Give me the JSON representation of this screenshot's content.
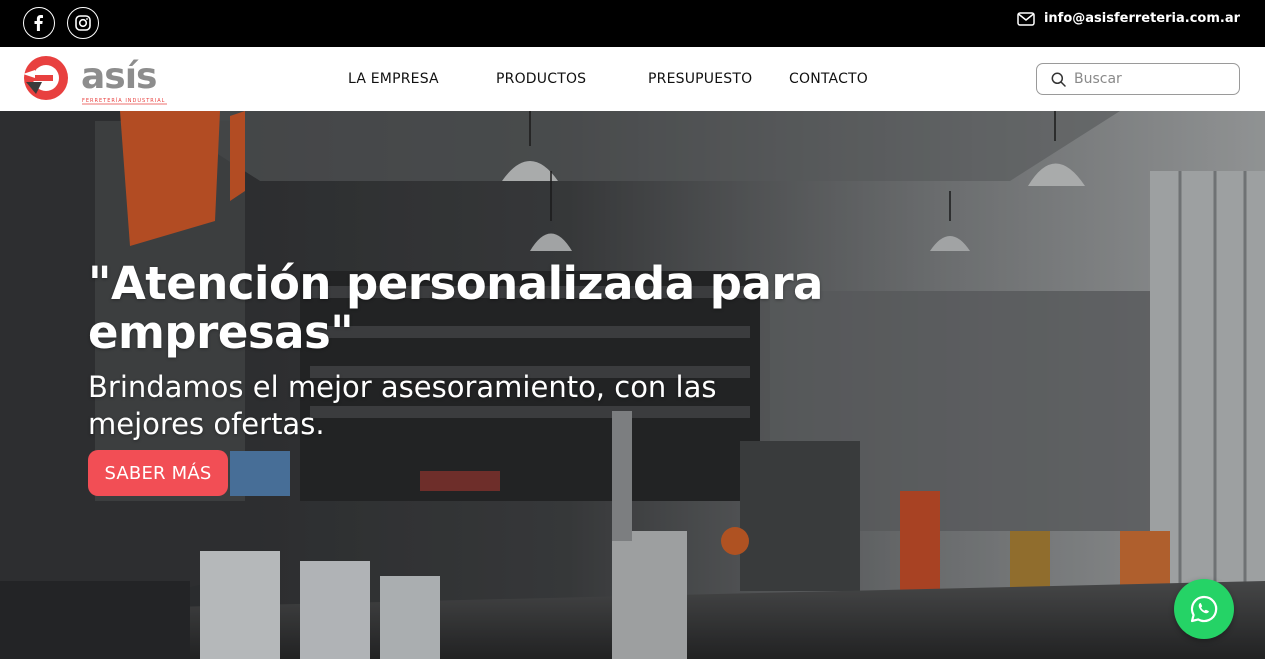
{
  "topbar": {
    "social": [
      {
        "name": "facebook-icon"
      },
      {
        "name": "instagram-icon"
      }
    ],
    "email": "info@asisferreteria.com.ar"
  },
  "header": {
    "logo_text": "asís",
    "logo_tagline": "FERRETERÍA INDUSTRIAL",
    "nav": [
      "LA EMPRESA",
      "PRODUCTOS",
      "PRESUPUESTO",
      "CONTACTO"
    ],
    "search_placeholder": "Buscar"
  },
  "hero": {
    "title": "\"Atención personalizada para empresas\"",
    "subtitle": "Brindamos el mejor asesoramiento, con las mejores ofertas.",
    "cta_label": "SABER MÁS"
  },
  "colors": {
    "accent": "#f24e55",
    "logo_red": "#e8403f",
    "logo_gray": "#8d8d8d",
    "whatsapp": "#25d366",
    "topbar": "#000000"
  }
}
